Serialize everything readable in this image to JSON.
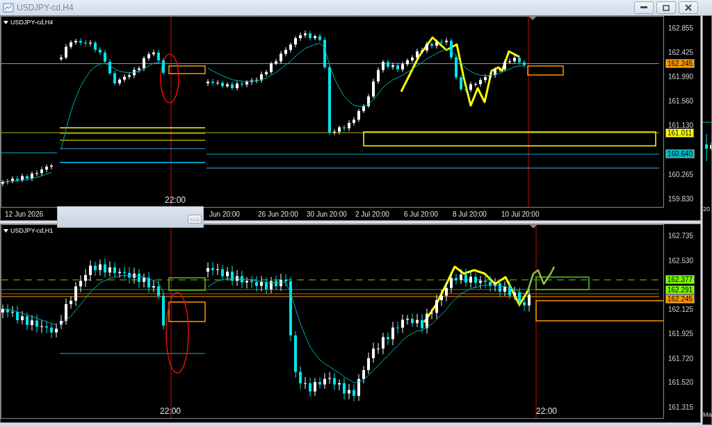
{
  "window": {
    "title": "USDJPY-cd,H4"
  },
  "charts": [
    {
      "header": "USDJPY-cd,H4",
      "price_ticks": [
        "162.855",
        "162.425",
        "161.990",
        "161.560",
        "161.130",
        "160.265",
        "159.830"
      ],
      "price_tags": [
        {
          "text": "162.245",
          "color": "#ff9900"
        },
        {
          "text": "161.011",
          "color": "#ffff00"
        },
        {
          "text": "160.640",
          "color": "#00c0c8"
        }
      ],
      "time_labels_left": [
        "12 Jun 2026"
      ],
      "time_labels": [
        "Jun 20:00",
        "26 Jun 20:00",
        "30 Jun 20:00",
        "2 Jul 20:00",
        "6 Jul 20:00",
        "8 Jul 20:00",
        "10 Jul 20:00"
      ],
      "cursor_labels": [
        "22:00"
      ]
    },
    {
      "header": "USDJPY-cd,H1",
      "price_ticks": [
        "162.735",
        "162.530",
        "162.125",
        "161.925",
        "161.720",
        "161.520",
        "161.315"
      ],
      "price_tags": [
        {
          "text": "162.377",
          "color": "#7cfc00"
        },
        {
          "text": "162.291",
          "color": "#7cfc00"
        },
        {
          "text": "162.245",
          "color": "#ff9900"
        }
      ],
      "cursor_labels": [
        "22:00",
        "22:00"
      ]
    }
  ],
  "side_chart": {
    "labels": [
      "20",
      "Ma"
    ]
  }
}
